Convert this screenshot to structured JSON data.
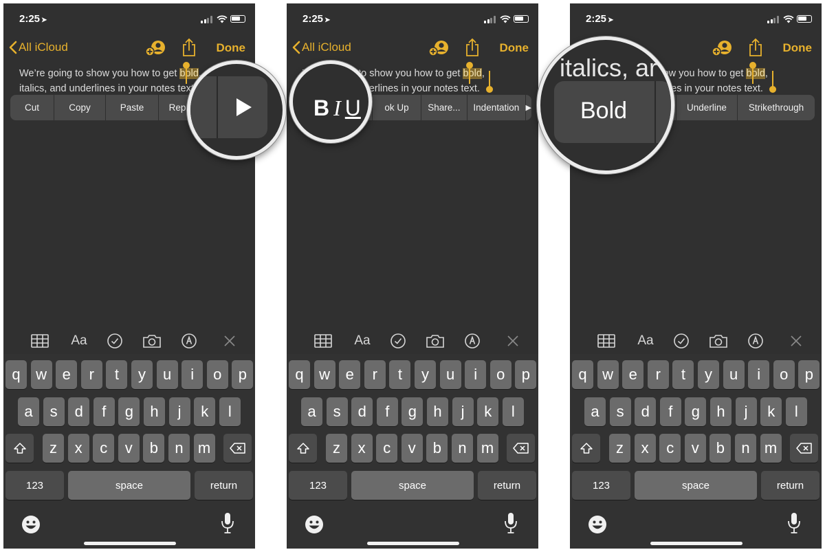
{
  "status": {
    "time": "2:25"
  },
  "nav": {
    "back_label": "All iCloud",
    "done_label": "Done"
  },
  "note": {
    "line1_prefix": "We’re going to show you how to get ",
    "selected_word": "bold",
    "line1_suffix": ",",
    "line2": "italics, and underlines in your notes text."
  },
  "menus": {
    "first": [
      "Cut",
      "Copy",
      "Paste",
      "Rep"
    ],
    "second": [
      "ok Up",
      "Share...",
      "Indentation"
    ],
    "third": [
      "Underline",
      "Strikethrough"
    ]
  },
  "magnifiers": {
    "biu": {
      "b": "B",
      "i": "I",
      "u": "U"
    },
    "third_bg_text": "italics, ar",
    "third_label": "Bold"
  },
  "toolbar": {
    "format_label": "Aa"
  },
  "keyboard": {
    "row1": [
      "q",
      "w",
      "e",
      "r",
      "t",
      "y",
      "u",
      "i",
      "o",
      "p"
    ],
    "row2": [
      "a",
      "s",
      "d",
      "f",
      "g",
      "h",
      "j",
      "k",
      "l"
    ],
    "row3": [
      "z",
      "x",
      "c",
      "v",
      "b",
      "n",
      "m"
    ],
    "numbers_label": "123",
    "space_label": "space",
    "return_label": "return"
  },
  "colors": {
    "accent": "#e7b12d",
    "background": "#303030",
    "key": "#6b6b6b",
    "key_dark": "#4b4b4b"
  }
}
